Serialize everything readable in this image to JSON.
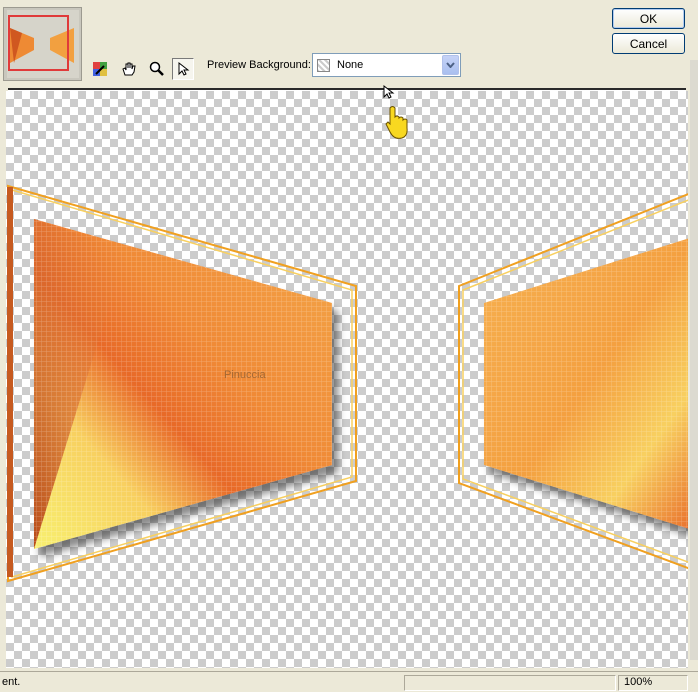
{
  "toolbar": {
    "tools": [
      {
        "name": "eyedropper-tool",
        "icon": "eyedropper-icon"
      },
      {
        "name": "pan-tool",
        "icon": "hand-icon"
      },
      {
        "name": "zoom-tool",
        "icon": "magnifier-icon"
      },
      {
        "name": "pointer-tool",
        "icon": "arrow-pointer-icon",
        "active": true
      }
    ],
    "preview_background_label": "Preview Background:",
    "preview_background_value": "None"
  },
  "buttons": {
    "ok_label": "OK",
    "cancel_label": "Cancel"
  },
  "preview": {
    "watermark": "Pinuccia",
    "colors": {
      "orange": "#f08a30",
      "yellow": "#f8e070",
      "dark_orange": "#c8501c",
      "border": "#f0a020"
    }
  },
  "status": {
    "text": "ent.",
    "zoom": "100%"
  }
}
